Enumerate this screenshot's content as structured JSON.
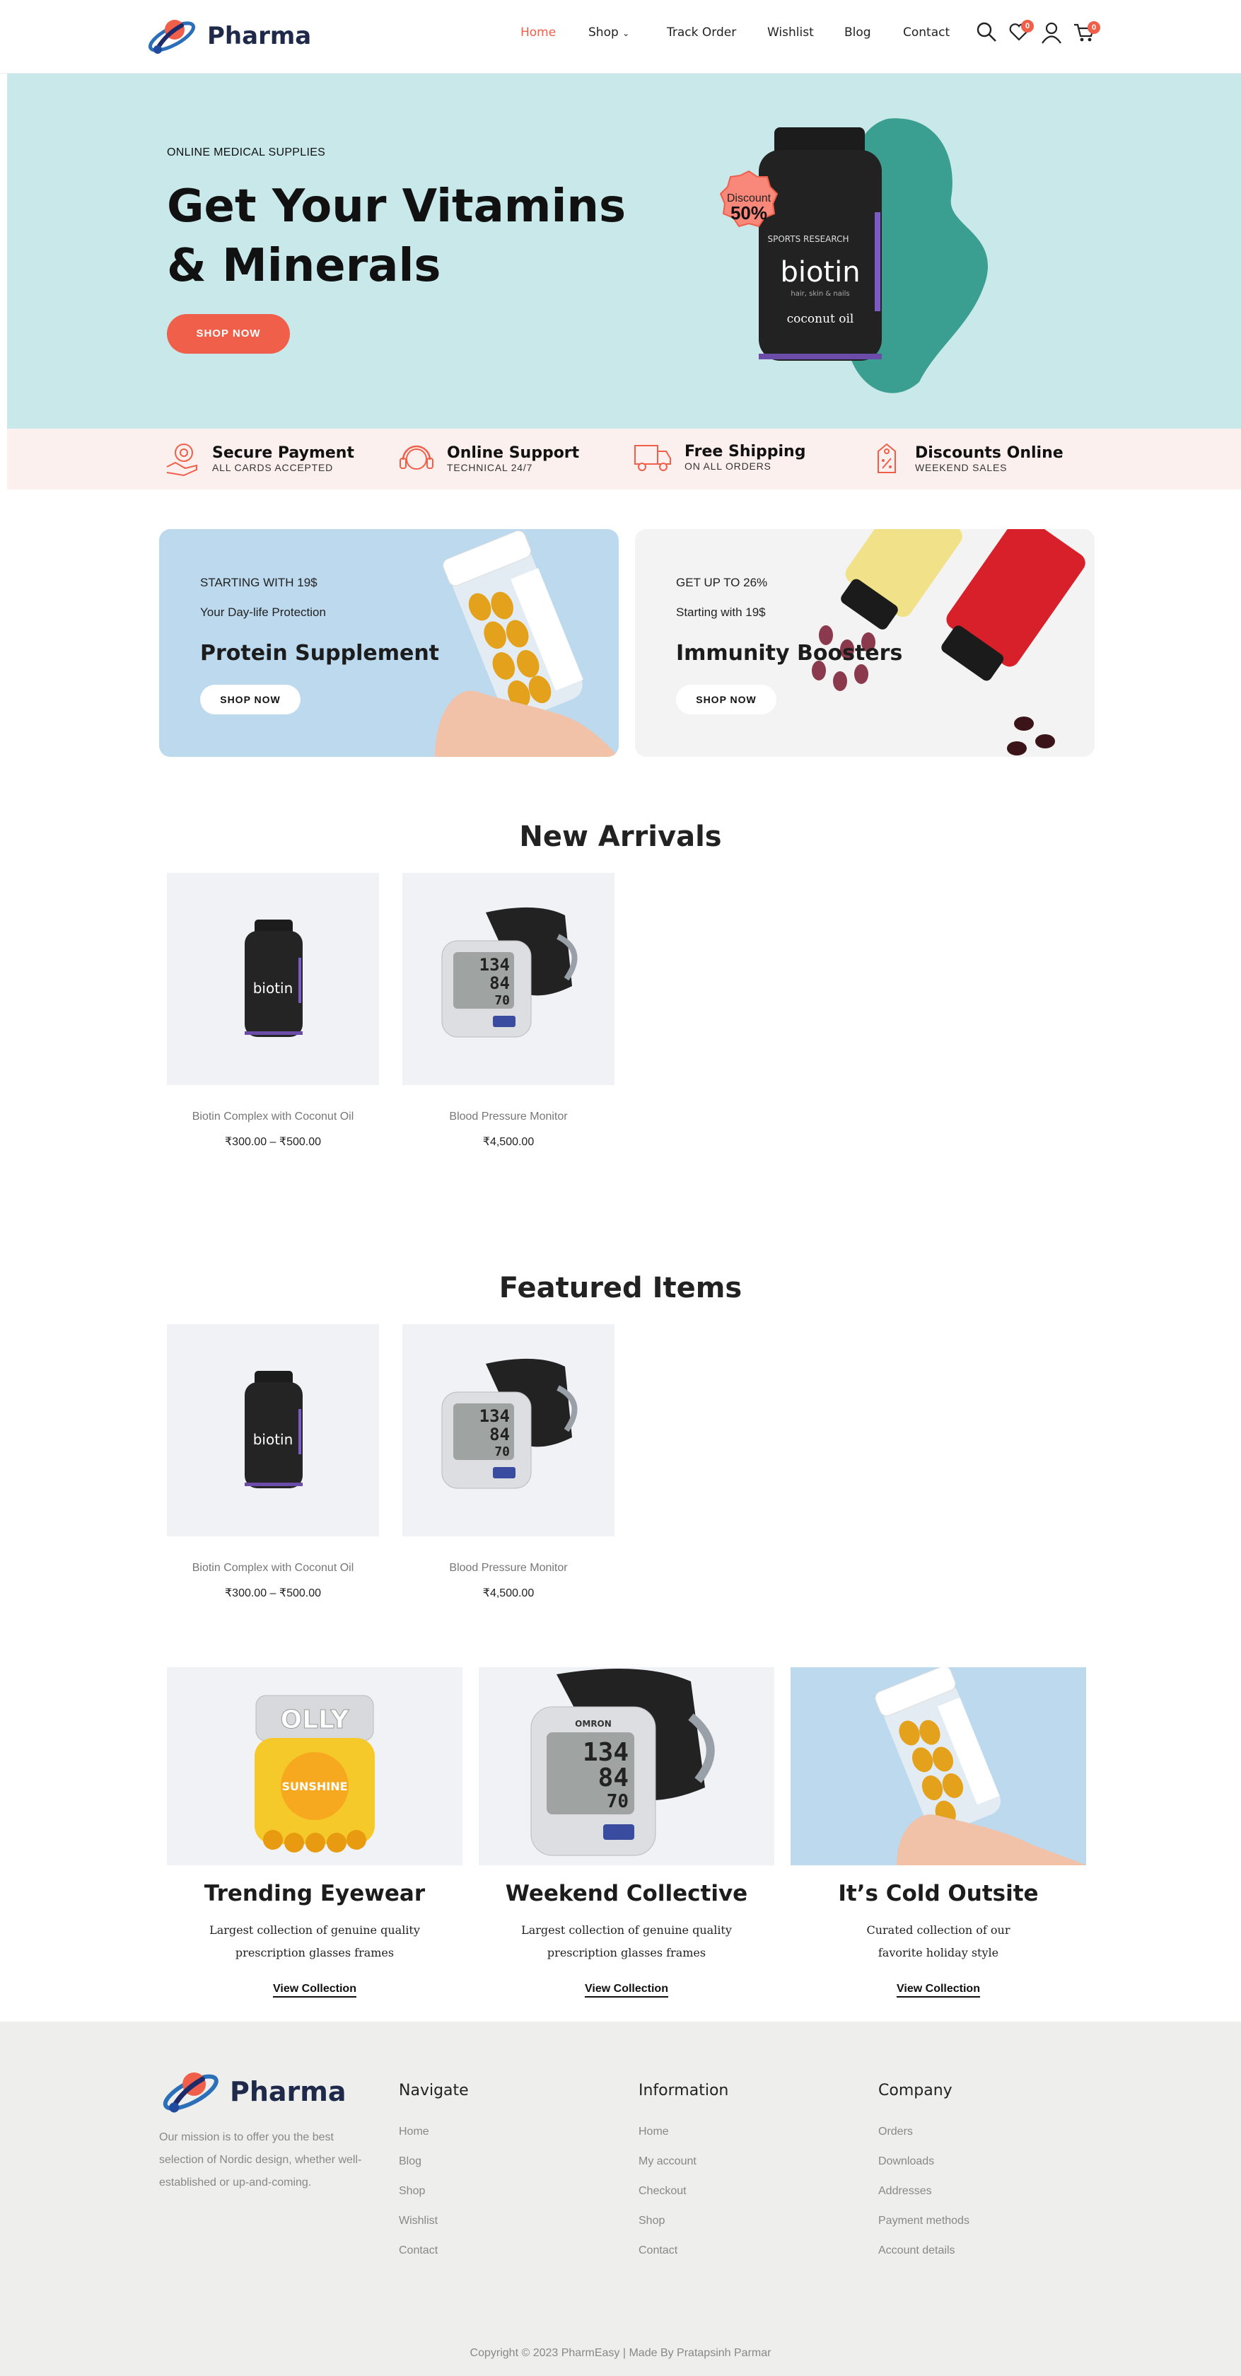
{
  "header": {
    "brand": "Pharma",
    "nav": [
      "Home",
      "Shop",
      "Track Order",
      "Wishlist",
      "Blog",
      "Contact"
    ],
    "wishlist_count": "0",
    "cart_count": "0"
  },
  "hero": {
    "kicker": "ONLINE MEDICAL SUPPLIES",
    "title": "Get Your Vitamins & Minerals",
    "cta": "SHOP NOW",
    "discount_label": "Discount",
    "discount_value": "50%",
    "product_label": "biotin",
    "product_sub": "hair, skin & nails",
    "product_brand": "SPORTS RESEARCH",
    "product_coconut": "coconut oil"
  },
  "features": [
    {
      "title": "Secure Payment",
      "sub": "ALL CARDS ACCEPTED",
      "icon": "secure-payment-icon"
    },
    {
      "title": "Online Support",
      "sub": "TECHNICAL 24/7",
      "icon": "headset-icon"
    },
    {
      "title": "Free Shipping",
      "sub": "ON ALL ORDERS",
      "icon": "truck-icon"
    },
    {
      "title": "Discounts Online",
      "sub": "WEEKEND SALES",
      "icon": "discount-tag-icon"
    }
  ],
  "promos": [
    {
      "k1": "STARTING WITH 19$",
      "k2": "Your Day-life Protection",
      "title": "Protein Supplement",
      "cta": "SHOP NOW"
    },
    {
      "k1": "GET UP TO 26%",
      "k2": "Starting with 19$",
      "title": "Immunity Boosters",
      "cta": "SHOP NOW"
    }
  ],
  "new_arrivals": {
    "title": "New Arrivals",
    "products": [
      {
        "name": "Biotin Complex with Coconut Oil",
        "price": "₹300.00 – ₹500.00"
      },
      {
        "name": "Blood Pressure Monitor",
        "price": "₹4,500.00"
      }
    ]
  },
  "featured": {
    "title": "Featured Items",
    "products": [
      {
        "name": "Biotin Complex with Coconut Oil",
        "price": "₹300.00 – ₹500.00"
      },
      {
        "name": "Blood Pressure Monitor",
        "price": "₹4,500.00"
      }
    ]
  },
  "collections": [
    {
      "title": "Trending Eyewear",
      "desc": "Largest collection of genuine quality prescription glasses frames",
      "link": "View Collection",
      "label_top": "OLLY",
      "label_mid": "SUNSHINE"
    },
    {
      "title": "Weekend Collective",
      "desc": "Largest collection of genuine quality prescription glasses frames",
      "link": "View Collection",
      "label_top": "OMRON"
    },
    {
      "title": "It’s Cold Outsite",
      "desc": "Curated collection of our favorite holiday style",
      "link": "View Collection"
    }
  ],
  "monitor_readings": [
    "134",
    "84",
    "70"
  ],
  "footer": {
    "brand": "Pharma",
    "mission": "Our mission is to offer you the best selection of Nordic design, whether well-established or up-and-coming.",
    "navigate": {
      "title": "Navigate",
      "links": [
        "Home",
        "Blog",
        "Shop",
        "Wishlist",
        "Contact"
      ]
    },
    "information": {
      "title": "Information",
      "links": [
        "Home",
        "My account",
        "Checkout",
        "Shop",
        "Contact"
      ]
    },
    "company": {
      "title": "Company",
      "links": [
        "Orders",
        "Downloads",
        "Addresses",
        "Payment methods",
        "Account details"
      ]
    },
    "copyright": "Copyright © 2023 PharmEasy | Made By Pratapsinh Parmar"
  },
  "colors": {
    "accent": "#f05f49",
    "hero_bg": "#c8e8ea",
    "strip_bg": "#fcf0ee",
    "teal_blob": "#3a9e90",
    "footer_bg": "#eeeeec"
  }
}
